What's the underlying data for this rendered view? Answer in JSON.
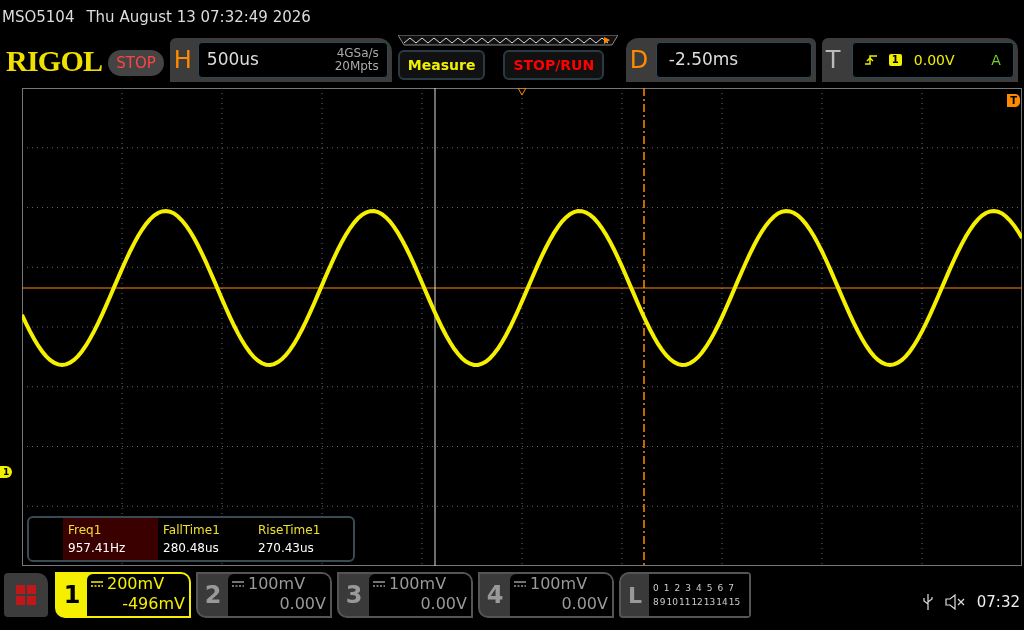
{
  "title_bar": {
    "model": "MSO5104",
    "datetime": "Thu August 13 07:32:49 2026"
  },
  "header": {
    "brand": "RIGOL",
    "run_state": "STOP",
    "horizontal": {
      "letter": "H",
      "timebase": "500us",
      "sample_rate": "4GSa/s",
      "memory_depth": "20Mpts"
    },
    "buttons": [
      {
        "label": "Measure",
        "kind": "menu"
      },
      {
        "label": "STOP/RUN",
        "kind": "run"
      }
    ],
    "delay": {
      "letter": "D",
      "value": "-2.50ms"
    },
    "trigger": {
      "letter": "T",
      "source": "1",
      "level": "0.00V",
      "mode": "A"
    }
  },
  "graticule": {
    "channel_marker": "1",
    "trigger_marker": "T"
  },
  "measurements": [
    {
      "label": "Freq1",
      "value": "957.41Hz",
      "selected": true
    },
    {
      "label": "FallTime1",
      "value": "280.48us",
      "selected": false
    },
    {
      "label": "RiseTime1",
      "value": "270.43us",
      "selected": false
    }
  ],
  "channels": [
    {
      "number": "1",
      "scale": "200mV",
      "offset": "-496mV",
      "on": true
    },
    {
      "number": "2",
      "scale": "100mV",
      "offset": "0.00V",
      "on": false
    },
    {
      "number": "3",
      "scale": "100mV",
      "offset": "0.00V",
      "on": false
    },
    {
      "number": "4",
      "scale": "100mV",
      "offset": "0.00V",
      "on": false
    }
  ],
  "logic": {
    "letter": "L",
    "bits_row1": [
      "0",
      "1",
      "2",
      "3",
      "4",
      "5",
      "6",
      "7"
    ],
    "bits_row2": [
      "8",
      "9",
      "10",
      "11",
      "12",
      "13",
      "14",
      "15"
    ]
  },
  "status": {
    "time": "07:32"
  }
}
